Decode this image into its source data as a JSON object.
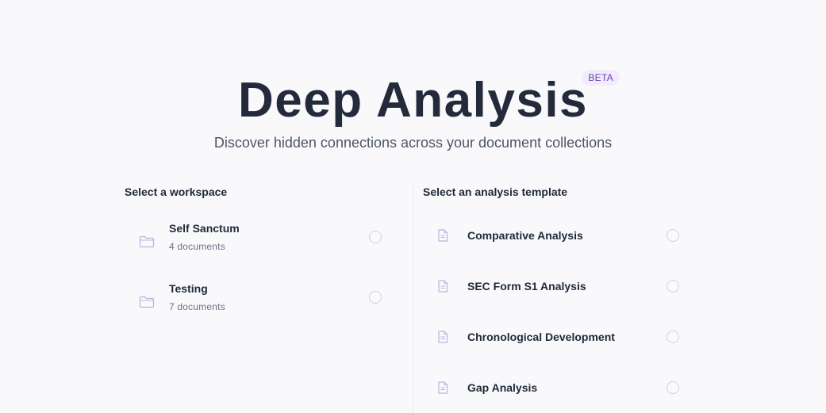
{
  "hero": {
    "title": "Deep Analysis",
    "badge": "BETA",
    "subtitle": "Discover hidden connections across your document collections"
  },
  "workspaces": {
    "heading": "Select a workspace",
    "items": [
      {
        "name": "Self Sanctum",
        "count": "4 documents",
        "icon": "folder-icon"
      },
      {
        "name": "Testing",
        "count": "7 documents",
        "icon": "folder-icon"
      }
    ]
  },
  "templates": {
    "heading": "Select an analysis template",
    "items": [
      {
        "name": "Comparative Analysis",
        "icon": "document-icon"
      },
      {
        "name": "SEC Form S1 Analysis",
        "icon": "document-icon"
      },
      {
        "name": "Chronological Development",
        "icon": "document-icon"
      },
      {
        "name": "Gap Analysis",
        "icon": "document-icon"
      }
    ]
  },
  "colors": {
    "background": "#f9f9fc",
    "title": "#232b3b",
    "badge_bg": "#f1ecfb",
    "badge_text": "#6b3fb5",
    "icon": "#b9b6dc"
  }
}
